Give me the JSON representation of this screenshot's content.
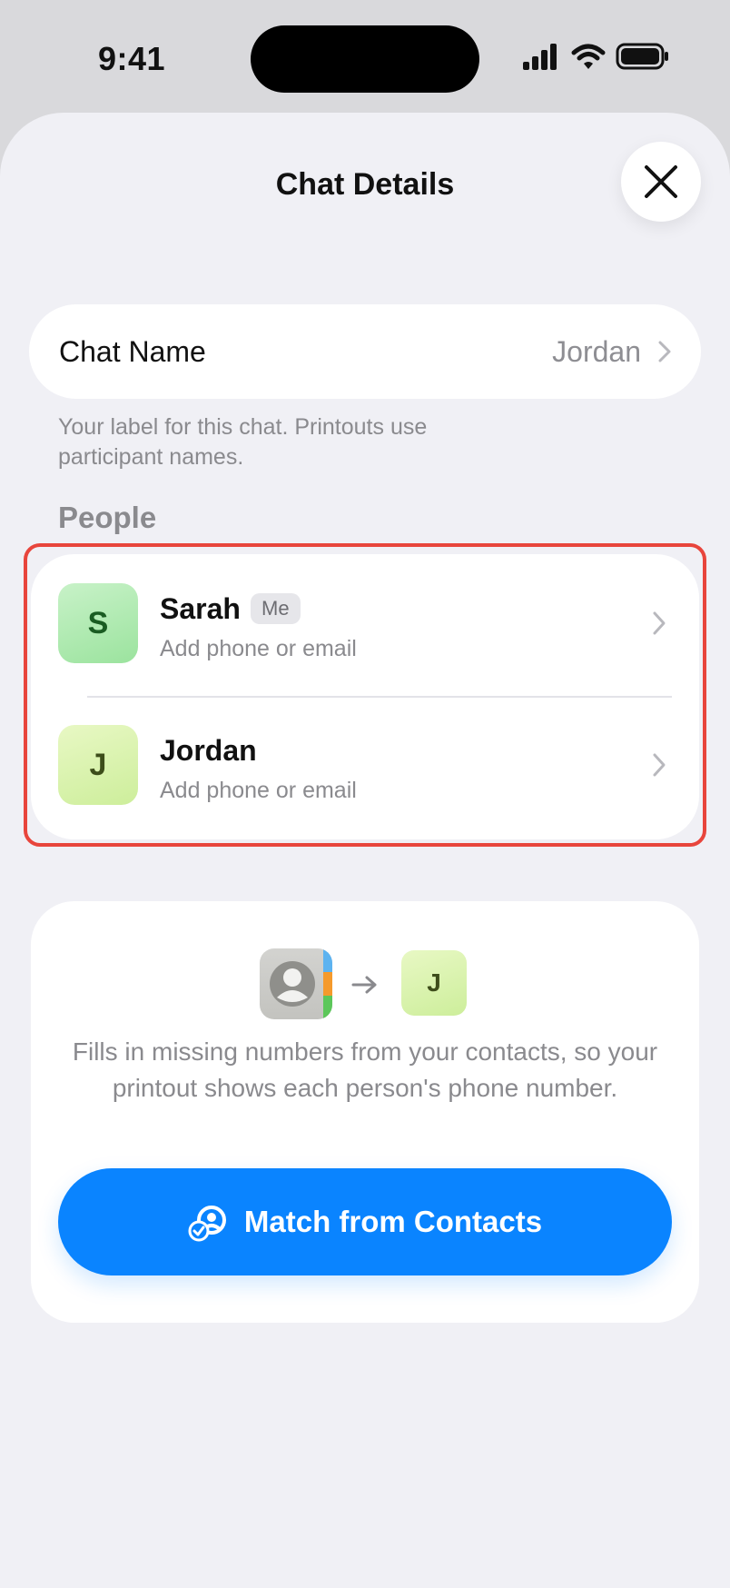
{
  "status_bar": {
    "time": "9:41"
  },
  "sheet": {
    "title": "Chat Details",
    "close_icon": "xmark-icon"
  },
  "chat_name": {
    "label": "Chat Name",
    "value": "Jordan",
    "helper": "Your label for this chat. Printouts use participant names."
  },
  "people": {
    "section_title": "People",
    "items": [
      {
        "initial": "S",
        "name": "Sarah",
        "badge": "Me",
        "subtitle": "Add phone or email",
        "avatar_color": "#a8e8aa"
      },
      {
        "initial": "J",
        "name": "Jordan",
        "badge": "",
        "subtitle": "Add phone or email",
        "avatar_color": "#d6f2a8"
      }
    ]
  },
  "match": {
    "target_initial": "J",
    "description": "Fills in missing numbers from your contacts, so your printout shows each person's phone number.",
    "button_label": "Match from Contacts"
  },
  "colors": {
    "accent": "#0a84ff",
    "highlight": "#e8453c",
    "sheet_bg": "#f0f0f5"
  }
}
